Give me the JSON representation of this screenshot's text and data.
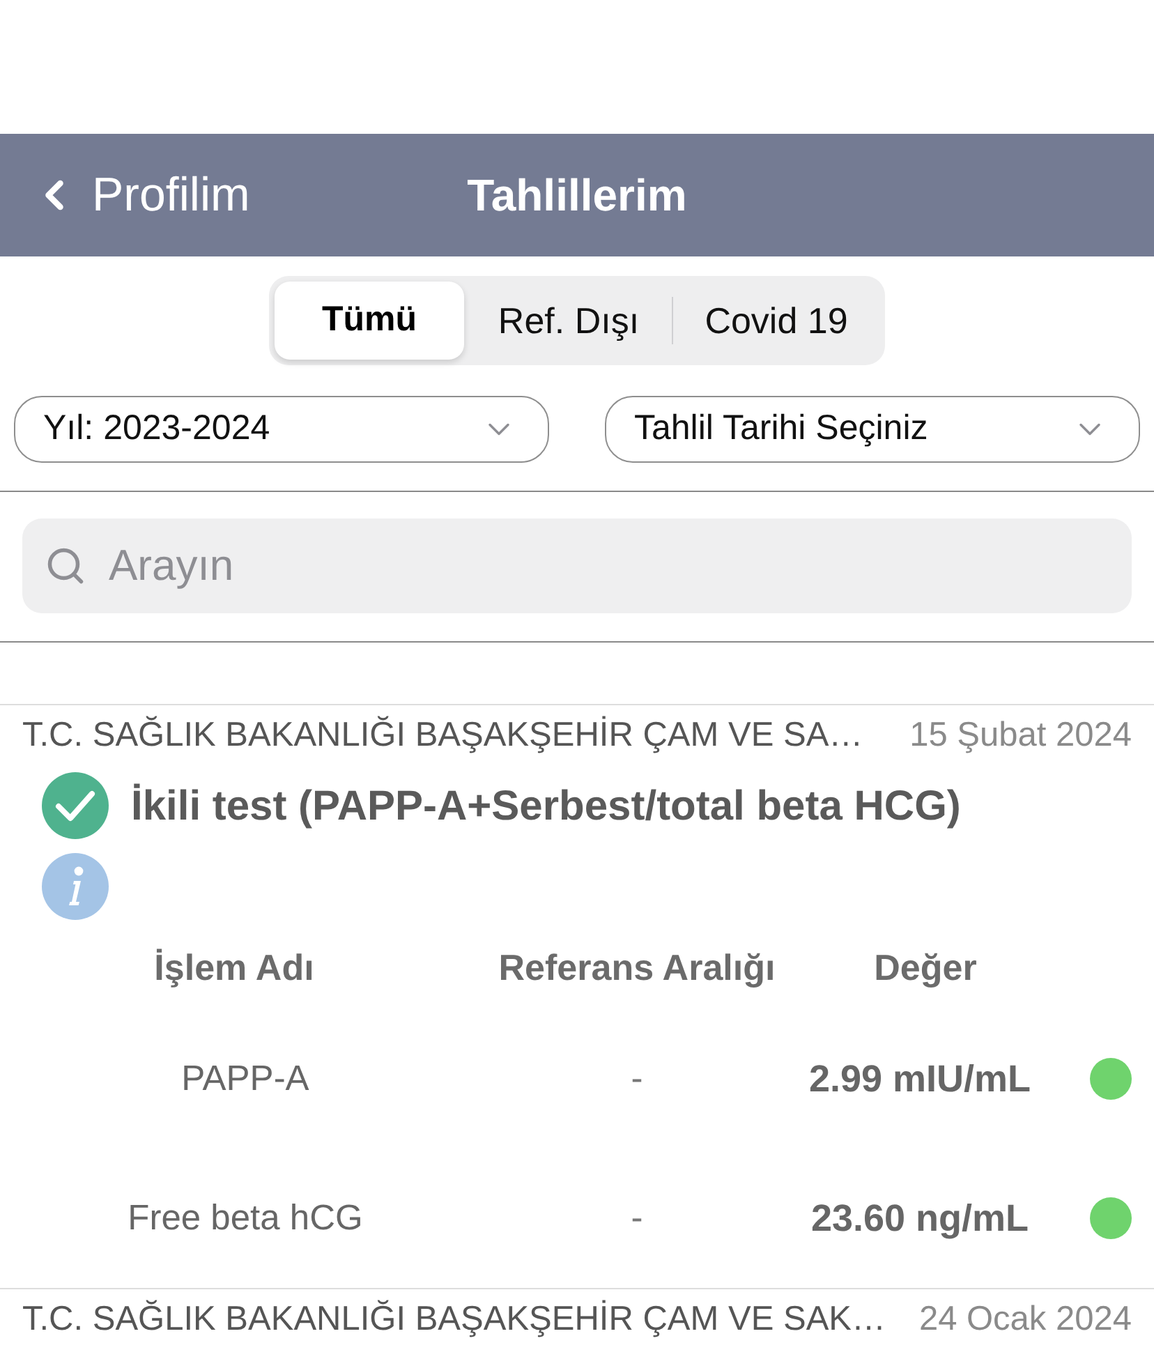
{
  "nav": {
    "back_label": "Profilim",
    "title": "Tahlillerim"
  },
  "segments": [
    {
      "label": "Tümü",
      "selected": true
    },
    {
      "label": "Ref. Dışı",
      "selected": false
    },
    {
      "label": "Covid 19",
      "selected": false
    }
  ],
  "filters": [
    {
      "value": "Yıl: 2023-2024"
    },
    {
      "value": "Tahlil Tarihi Seçiniz"
    }
  ],
  "search": {
    "placeholder": "Arayın"
  },
  "results": [
    {
      "institution": "T.C. SAĞLIK BAKANLIĞI BAŞAKŞEHİR ÇAM VE SA…",
      "date": "15 Şubat 2024",
      "title": "İkili test (PAPP-A+Serbest/total beta HCG)",
      "verified": true,
      "columns": [
        "İşlem Adı",
        "Referans Aralığı",
        "Değer"
      ],
      "rows": [
        {
          "name": "PAPP-A",
          "reference": "-",
          "value": "2.99 mIU/mL",
          "color": "#6fd36d"
        },
        {
          "name": "Free beta hCG",
          "reference": "-",
          "value": "23.60 ng/mL",
          "color": "#6fd36d"
        }
      ]
    },
    {
      "institution": "T.C. SAĞLIK BAKANLIĞI BAŞAKŞEHİR ÇAM VE SAK…",
      "date": "24 Ocak 2024"
    }
  ]
}
